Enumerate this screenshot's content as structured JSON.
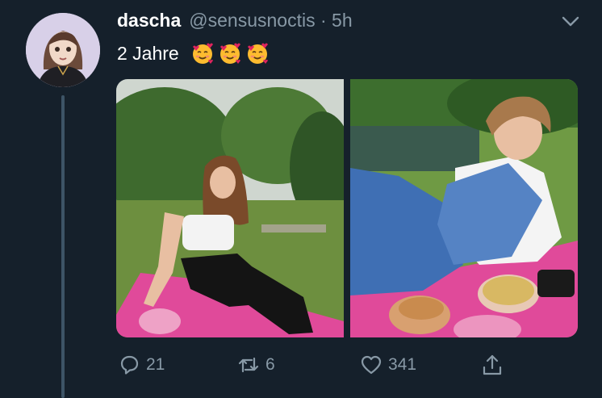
{
  "tweet": {
    "display_name": "dascha",
    "handle": "@sensusnoctis",
    "separator": "·",
    "time": "5h",
    "text": "2 Jahre",
    "emoji": "smiling-face-with-hearts"
  },
  "actions": {
    "reply_count": "21",
    "retweet_count": "6",
    "like_count": "341"
  },
  "colors": {
    "background": "#15202b",
    "secondary_text": "#8899a6",
    "thread_line": "#3d5466"
  }
}
